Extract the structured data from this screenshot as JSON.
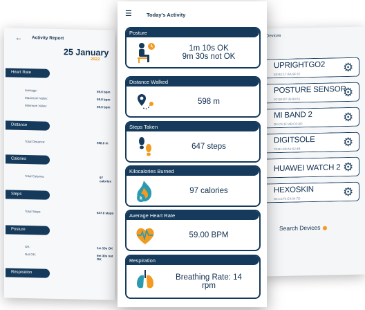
{
  "report": {
    "title": "Activity Report",
    "date": "25 January",
    "year": "2022",
    "sections": [
      {
        "label": "Heart Rate",
        "rows": [
          {
            "label": "Average:",
            "value": "59.0 bpm"
          },
          {
            "label": "Maximum Value:",
            "value": "59.0 bpm"
          },
          {
            "label": "Minimum Value:",
            "value": "59.0 bpm"
          }
        ]
      },
      {
        "label": "Distance",
        "rows": [
          {
            "label": "Total Distance:",
            "value": "598.0 m"
          }
        ]
      },
      {
        "label": "Calories",
        "rows": [
          {
            "label": "Total Calories:",
            "value": "97 calories"
          }
        ]
      },
      {
        "label": "Steps",
        "rows": [
          {
            "label": "Total Steps:",
            "value": "647.0 steps"
          }
        ]
      },
      {
        "label": "Posture",
        "rows": [
          {
            "label": "OK:",
            "value": "1m 10s OK"
          },
          {
            "label": "Not OK:",
            "value": "9m 30s not OK"
          }
        ]
      },
      {
        "label": "Respiration",
        "rows": []
      }
    ]
  },
  "activity": {
    "title": "Today's Activity",
    "cards": [
      {
        "label": "Posture",
        "line1": "1m 10s OK",
        "line2": "9m 30s not OK",
        "icon": "posture-icon"
      },
      {
        "label": "Distance Walked",
        "line1": "598 m",
        "line2": "",
        "icon": "location-path-icon"
      },
      {
        "label": "Steps Taken",
        "line1": "647 steps",
        "line2": "",
        "icon": "footprints-icon"
      },
      {
        "label": "Kilocalories Burned",
        "line1": "97 calories",
        "line2": "",
        "icon": "flame-kcal-icon"
      },
      {
        "label": "Average Heart Rate",
        "line1": "59.00 BPM",
        "line2": "",
        "icon": "heart-pulse-icon"
      },
      {
        "label": "Respiration",
        "line1": "Breathing Rate: 14",
        "line2": "rpm",
        "icon": "lungs-icon"
      }
    ]
  },
  "devices": {
    "title": "Devices",
    "items": [
      {
        "name": "UPRIGHTGO2",
        "address": "E8:B1:17:AA:9F:67"
      },
      {
        "name": "POSTURE SENSOR",
        "address": "0C:B2:B7:39:99:63"
      },
      {
        "name": "MI BAND 2",
        "address": "D4:C5:1C:AB:C0:AD"
      },
      {
        "name": "DIGITSOLE",
        "address": "70:B1:3D:A1:62:4B"
      },
      {
        "name": "HUAWEI WATCH 2",
        "address": ""
      },
      {
        "name": "HEXOSKIN",
        "address": "00:C3:F4:E4:04:7D"
      }
    ],
    "search_label": "Search Devices"
  },
  "colors": {
    "navy": "#153a5b",
    "orange": "#f39a20",
    "green": "#3fae3a",
    "teal": "#2a9ab0"
  }
}
